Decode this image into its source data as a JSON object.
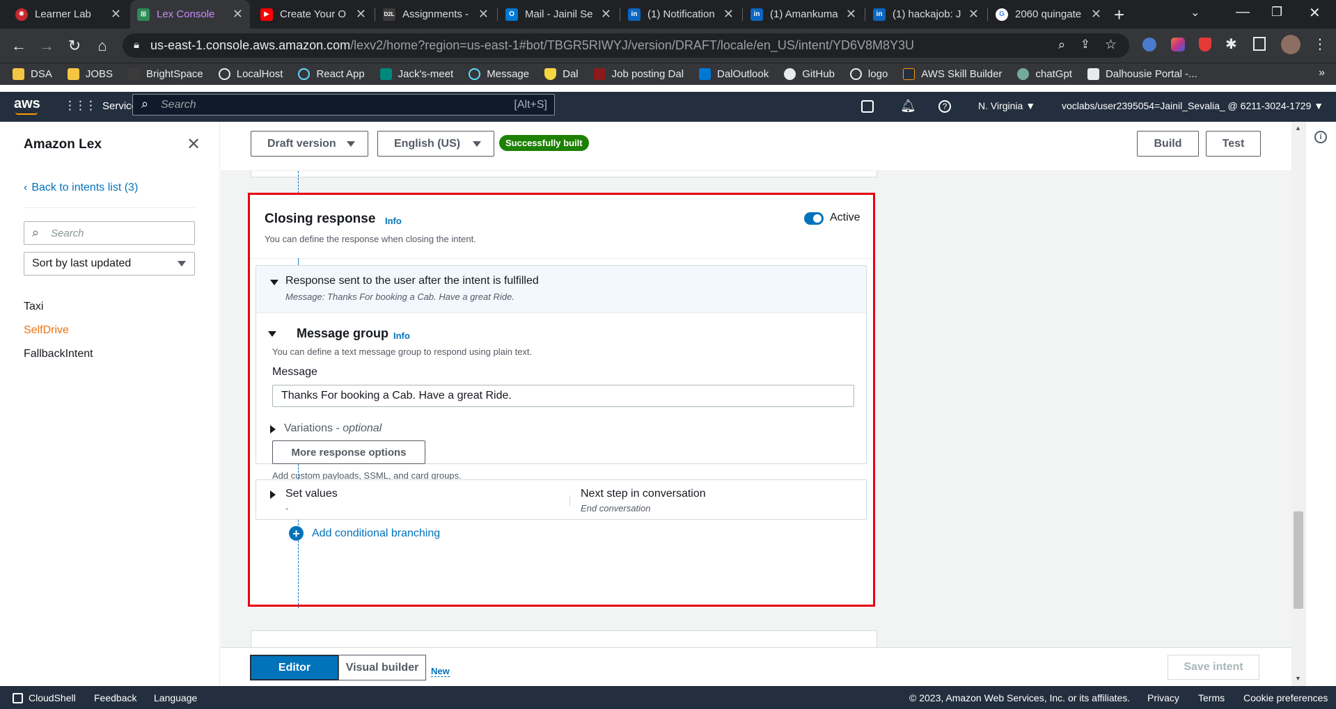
{
  "browser": {
    "tabs": [
      {
        "title": "Learner Lab",
        "icon": "learner-lab-icon",
        "color": "#c5282f"
      },
      {
        "title": "Lex Console",
        "icon": "lex-icon",
        "color": "#2e8b57"
      },
      {
        "title": "Create Your O",
        "icon": "youtube-icon",
        "color": "#ff0000"
      },
      {
        "title": "Assignments -",
        "icon": "d2l-icon",
        "color": "#3b3b3b"
      },
      {
        "title": "Mail - Jainil Se",
        "icon": "outlook-icon",
        "color": "#0078d4"
      },
      {
        "title": "(1) Notification",
        "icon": "linkedin-icon",
        "color": "#0a66c2"
      },
      {
        "title": "(1) Amankuma",
        "icon": "linkedin-icon",
        "color": "#0a66c2"
      },
      {
        "title": "(1) hackajob: J",
        "icon": "linkedin-icon",
        "color": "#0a66c2"
      },
      {
        "title": "2060 quingate",
        "icon": "google-icon",
        "color": "#ffffff"
      }
    ],
    "url_host": "us-east-1.console.aws.amazon.com",
    "url_path": "/lexv2/home?region=us-east-1#bot/TBGR5RIWYJ/version/DRAFT/locale/en_US/intent/YD6V8M8Y3U",
    "bookmarks": [
      "DSA",
      "JOBS",
      "BrightSpace",
      "LocalHost",
      "React App",
      "Jack's-meet",
      "Message",
      "Dal",
      "Job posting Dal",
      "DalOutlook",
      "GitHub",
      "logo",
      "AWS Skill Builder",
      "chatGpt",
      "Dalhousie Portal -..."
    ]
  },
  "aws": {
    "logo": "aws",
    "services": "Services",
    "search_placeholder": "Search",
    "search_shortcut": "[Alt+S]",
    "region": "N. Virginia ▼",
    "account": "voclabs/user2395054=Jainil_Sevalia_ @ 6211-3024-1729 ▼"
  },
  "sidebar": {
    "title": "Amazon Lex",
    "back_link": "Back to intents list (3)",
    "search_placeholder": "Search",
    "sort": "Sort by last updated",
    "intents": [
      "Taxi",
      "SelfDrive",
      "FallbackIntent"
    ]
  },
  "topbar": {
    "version": "Draft version",
    "language": "English (US)",
    "status": "Successfully built",
    "build": "Build",
    "test": "Test"
  },
  "closing": {
    "title": "Closing response",
    "info": "Info",
    "description": "You can define the response when closing the intent.",
    "active_label": "Active",
    "response_title": "Response sent to the user after the intent is fulfilled",
    "response_subtitle": "Message: Thanks For booking a Cab. Have a great Ride.",
    "message_group_title": "Message group",
    "message_group_info": "Info",
    "message_group_desc": "You can define a text message group to respond using plain text.",
    "message_label": "Message",
    "message_value": "Thanks For booking a Cab. Have a great Ride.",
    "variations_label": "Variations -",
    "variations_optional": "optional",
    "more_options": "More response options",
    "more_desc": "Add custom payloads, SSML, and card groups.",
    "set_values_label": "Set values",
    "set_values_value": "-",
    "next_step_label": "Next step in conversation",
    "next_step_value": "End conversation",
    "add_branching": "Add conditional branching"
  },
  "bottombar": {
    "editor": "Editor",
    "visual_builder": "Visual builder",
    "new_badge": "New",
    "save": "Save intent"
  },
  "footer": {
    "cloudshell": "CloudShell",
    "feedback": "Feedback",
    "language": "Language",
    "copyright": "© 2023, Amazon Web Services, Inc. or its affiliates.",
    "privacy": "Privacy",
    "terms": "Terms",
    "cookies": "Cookie preferences"
  },
  "colors": {
    "aws_nav": "#232f3e",
    "link": "#0073bb",
    "selected_intent": "#ec7211",
    "success": "#1d8102",
    "highlight_box": "#e60012"
  }
}
